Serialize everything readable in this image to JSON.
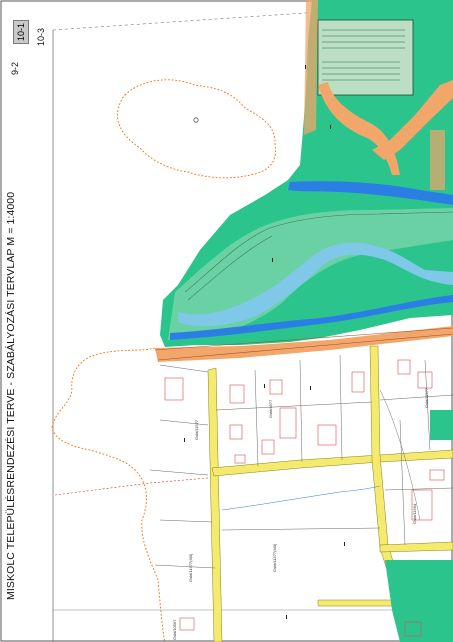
{
  "title": "MISKOLC TELEPÜLÉSRENDEZÉSI TERVE  -  SZABÁLYOZÁSI TERVLAP M = 1:4000",
  "sheet_index": {
    "current": "10-1",
    "below": "10-3",
    "left": "9-2"
  },
  "parcel_labels": [
    "Gskt/11577",
    "Gskt/4677",
    "Gskt/11577",
    "Gskt/11577(M0)",
    "Gskt/11577(M0)",
    "Gskt/11564",
    "Gskt/10567"
  ],
  "colors": {
    "forest": "#2bc48d",
    "river": "#7fc8e8",
    "stream": "#2b7ee3",
    "road": "#f4ea6e",
    "embankment": "#f2a66a",
    "boundary": "#ff6a00",
    "building": "#d45050"
  }
}
